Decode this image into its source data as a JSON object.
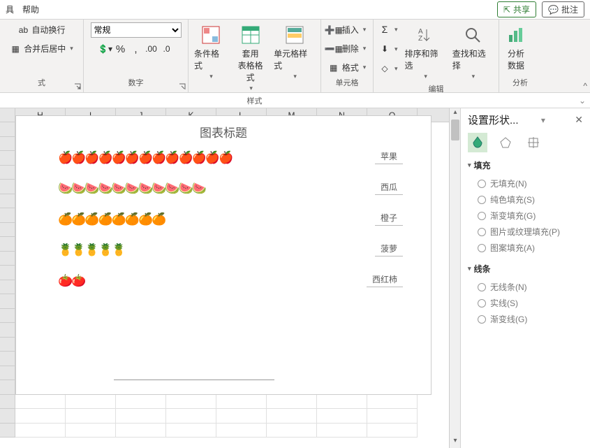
{
  "topbar": {
    "left": [
      "具",
      "帮助"
    ],
    "share": "共享",
    "annotate": "批注"
  },
  "ribbon": {
    "align": {
      "wrap": "自动换行",
      "merge": "合并后居中"
    },
    "number": {
      "label": "数字",
      "format": "常规"
    },
    "styles": {
      "label": "样式",
      "cond": "条件格式",
      "table": "套用\n表格格式",
      "cell": "单元格样式"
    },
    "cells": {
      "label": "单元格",
      "insert": "插入",
      "delete": "删除",
      "format": "格式"
    },
    "edit": {
      "label": "编辑",
      "sort": "排序和筛选",
      "find": "查找和选择"
    },
    "analysis": {
      "label": "分析",
      "btn": "分析\n数据"
    }
  },
  "columns": [
    "H",
    "I",
    "J",
    "K",
    "L",
    "M",
    "N",
    "O"
  ],
  "chart_data": {
    "type": "bar",
    "title": "图表标题",
    "categories": [
      "苹果",
      "西瓜",
      "橙子",
      "菠萝",
      "西红柿"
    ],
    "values": [
      13,
      11,
      8,
      5,
      2
    ],
    "icons": [
      "🍎",
      "🍉",
      "🍊",
      "🍍",
      "🍅"
    ],
    "xlabel": "",
    "ylabel": "",
    "ylim": [
      0,
      14
    ]
  },
  "pane": {
    "title": "设置形状...",
    "fill": {
      "label": "填充",
      "opts": [
        "无填充(N)",
        "纯色填充(S)",
        "渐变填充(G)",
        "图片或纹理填充(P)",
        "图案填充(A)"
      ]
    },
    "line": {
      "label": "线条",
      "opts": [
        "无线条(N)",
        "实线(S)",
        "渐变线(G)"
      ]
    }
  }
}
